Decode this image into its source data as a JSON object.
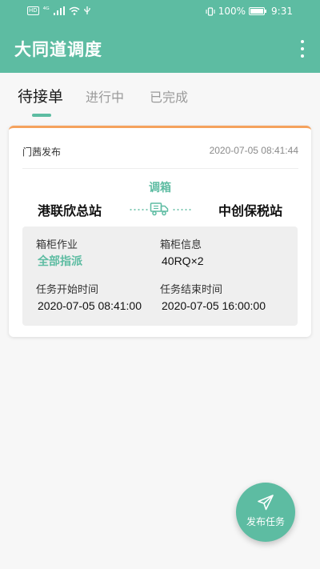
{
  "statusbar": {
    "hd_badge": "HD",
    "network": "⁴ᴳ",
    "battery_percent": "100%",
    "time": "9:31"
  },
  "appbar": {
    "title": "大同道调度",
    "menu_icon": "more-vert-icon"
  },
  "tabs": [
    {
      "label": "待接单",
      "active": true
    },
    {
      "label": "进行中",
      "active": false
    },
    {
      "label": "已完成",
      "active": false
    }
  ],
  "task_card": {
    "publisher": "门茜发布",
    "published_at": "2020-07-05 08:41:44",
    "route_type": "调箱",
    "from_station": "港联欣总站",
    "to_station": "中创保税站",
    "route_icon": "truck-icon",
    "container_operation_label": "箱柜作业",
    "container_operation_value": "全部指派",
    "container_info_label": "箱柜信息",
    "container_info_value": "40RQ×2",
    "start_time_label": "任务开始时间",
    "start_time_value": "2020-07-05 08:41:00",
    "end_time_label": "任务结束时间",
    "end_time_value": "2020-07-05 16:00:00"
  },
  "fab": {
    "label": "发布任务",
    "icon": "send-icon"
  },
  "colors": {
    "primary": "#5dbca2",
    "card_top_border": "#f5a25d"
  }
}
